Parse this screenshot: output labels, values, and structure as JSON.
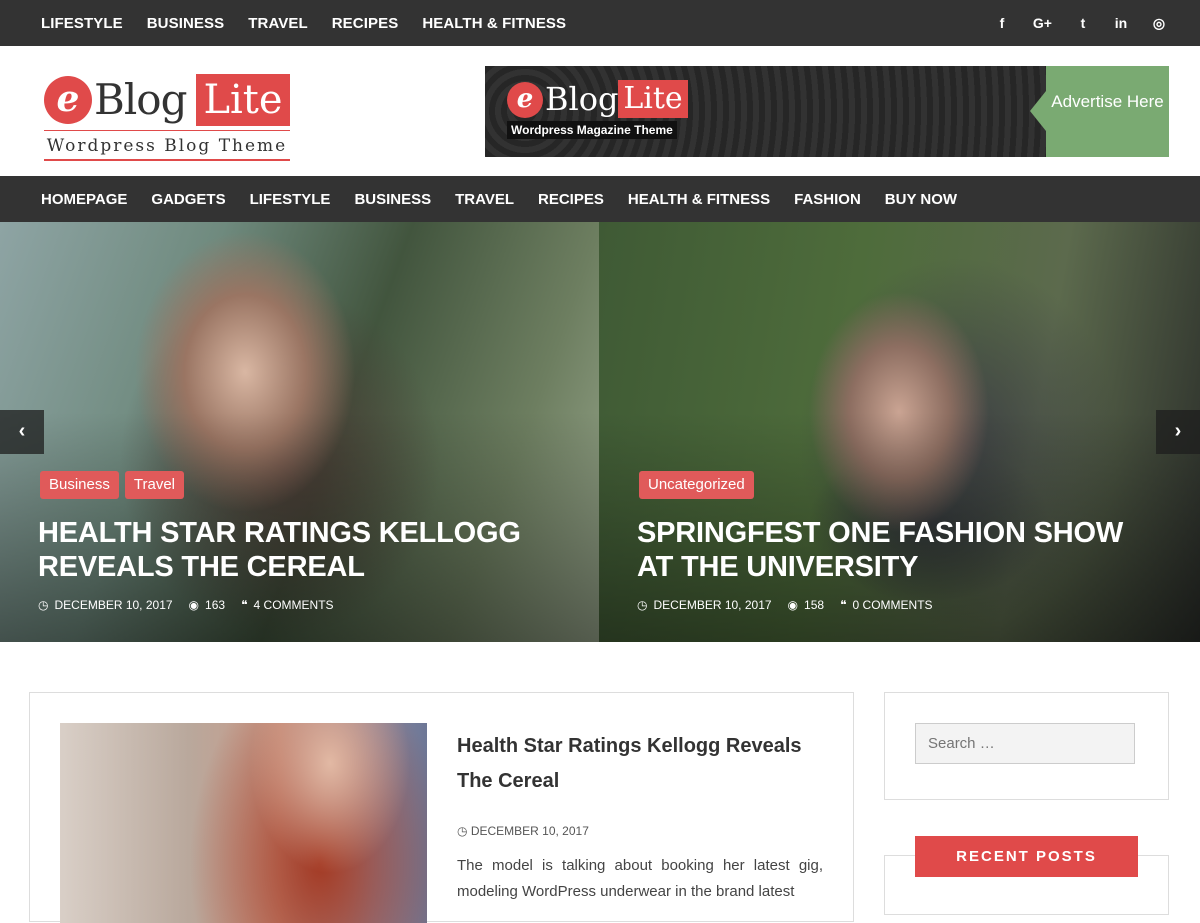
{
  "top_menu": [
    "LIFESTYLE",
    "BUSINESS",
    "TRAVEL",
    "RECIPES",
    "HEALTH & FITNESS"
  ],
  "social": [
    {
      "icon": "facebook-icon",
      "glyph": "f"
    },
    {
      "icon": "google-plus-icon",
      "glyph": "G+"
    },
    {
      "icon": "twitter-icon",
      "glyph": "t"
    },
    {
      "icon": "linkedin-icon",
      "glyph": "in"
    },
    {
      "icon": "instagram-icon",
      "glyph": "◎"
    }
  ],
  "logo": {
    "e": "e",
    "blog": "Blog",
    "lite": "Lite",
    "tagline": "Wordpress Blog Theme"
  },
  "ad": {
    "e": "e",
    "blog": "Blog",
    "lite": "Lite",
    "subtitle": "Wordpress Magazine Theme",
    "cta": "Advertise Here"
  },
  "main_menu": [
    "HOMEPAGE",
    "GADGETS",
    "LIFESTYLE",
    "BUSINESS",
    "TRAVEL",
    "RECIPES",
    "HEALTH & FITNESS",
    "FASHION",
    "BUY NOW"
  ],
  "slides": [
    {
      "categories": [
        "Business",
        "Travel"
      ],
      "title": "HEALTH STAR RATINGS KELLOGG REVEALS THE CEREAL",
      "date": "DECEMBER 10, 2017",
      "views": "163",
      "comments": "4 COMMENTS"
    },
    {
      "categories": [
        "Uncategorized"
      ],
      "title": "SPRINGFEST ONE FASHION SHOW AT THE UNIVERSITY",
      "date": "DECEMBER 10, 2017",
      "views": "158",
      "comments": "0 COMMENTS"
    }
  ],
  "slider_arrows": {
    "prev": "‹",
    "next": "›"
  },
  "post": {
    "title": "Health Star Ratings Kellogg Reveals The Cereal",
    "date": "DECEMBER 10, 2017",
    "excerpt": "The model is talking about booking her latest gig, modeling WordPress underwear in the brand latest"
  },
  "sidebar": {
    "search_placeholder": "Search …",
    "recent_posts_title": "RECENT POSTS"
  },
  "colors": {
    "accent": "#e04a4a",
    "dark_bar": "#333333",
    "ad_green": "#7aaa72"
  }
}
